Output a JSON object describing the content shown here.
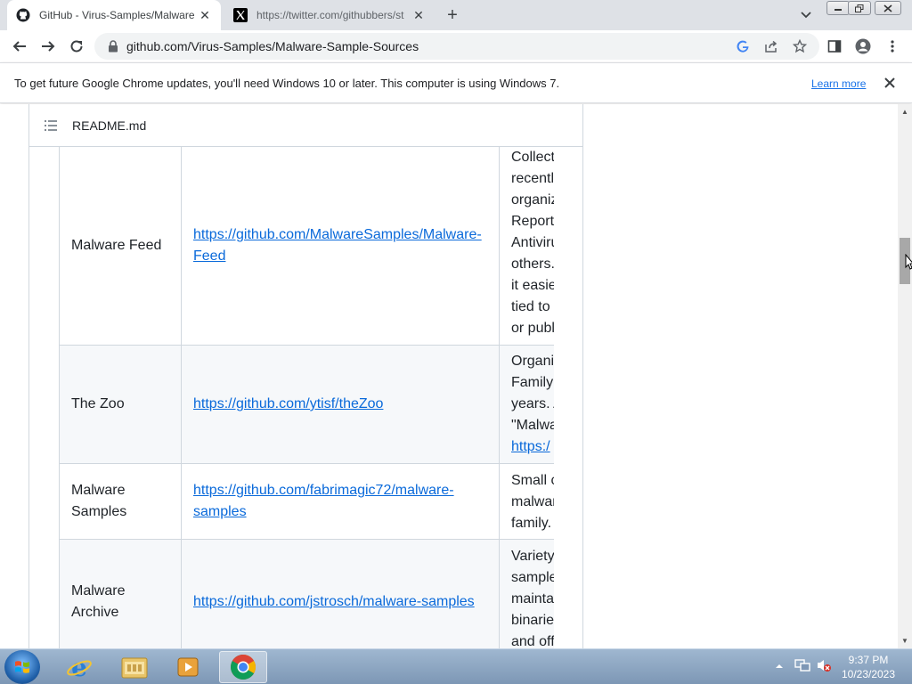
{
  "browser": {
    "tabs": [
      {
        "title": "GitHub - Virus-Samples/Malware",
        "favicon": "github-icon",
        "active": true
      },
      {
        "title": "https://twitter.com/githubbers/st",
        "favicon": "x-twitter-icon",
        "active": false
      }
    ],
    "new_tab_label": "+",
    "url": "github.com/Virus-Samples/Malware-Sample-Sources"
  },
  "infobar": {
    "message": "To get future Google Chrome updates, you'll need Windows 10 or later. This computer is using Windows 7.",
    "link": "Learn more"
  },
  "readme": {
    "filename": "README.md"
  },
  "table": {
    "rows": [
      {
        "name": "Malware Feed",
        "link": "https://github.com/MalwareSamples/Malware-Feed",
        "link_lines": [
          "https://github.com/MalwareSamples/Malware-",
          "Feed"
        ],
        "desc_lines": [
          "Collect",
          "recently",
          "organiz",
          "Reports",
          "Antiviru",
          "others.",
          "it easie",
          "tied to",
          "or publ"
        ]
      },
      {
        "name": "The Zoo",
        "link": "https://github.com/ytisf/theZoo",
        "link_lines": [
          "https://github.com/ytisf/theZoo"
        ],
        "desc_lines": [
          "Organiz",
          "Family",
          "years. A",
          "\"Malwa",
          "https:/"
        ]
      },
      {
        "name": "Malware Samples",
        "link": "https://github.com/fabrimagic72/malware-samples",
        "link_lines": [
          "https://github.com/fabrimagic72/malware-",
          "samples"
        ],
        "desc_lines": [
          "Small c",
          "malwar",
          "family."
        ]
      },
      {
        "name": "Malware Archive",
        "link": "https://github.com/jstrosch/malware-samples",
        "link_lines": [
          "https://github.com/jstrosch/malware-samples"
        ],
        "desc_lines": [
          "Variety",
          "sample",
          "mainta",
          "binarie",
          "and off"
        ]
      }
    ]
  },
  "taskbar": {
    "apps": [
      "internet-explorer",
      "windows-explorer",
      "media-player",
      "google-chrome"
    ],
    "clock_time": "9:37 PM",
    "clock_date": "10/23/2023"
  }
}
